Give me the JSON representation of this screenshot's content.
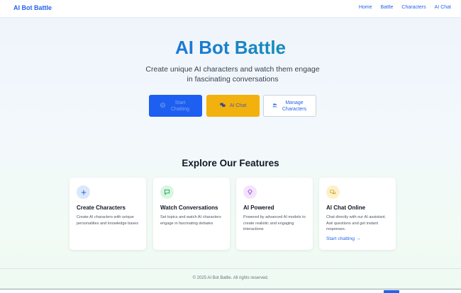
{
  "header": {
    "brand": "AI Bot Battle",
    "nav": [
      "Home",
      "Battle",
      "Characters",
      "AI Chat"
    ]
  },
  "hero": {
    "title": "AI Bot Battle",
    "subtitle": "Create unique AI characters and watch them engage in fascinating conversations",
    "buttons": {
      "start": "Start Chatting",
      "chat": "AI Chat",
      "manage": "Manage Characters"
    }
  },
  "features": {
    "title": "Explore Our Features",
    "cards": [
      {
        "icon": "plus-icon",
        "title": "Create Characters",
        "desc": "Create AI characters with unique personalities and knowledge bases"
      },
      {
        "icon": "message-square-icon",
        "title": "Watch Conversations",
        "desc": "Set topics and watch AI characters engage in fascinating debates"
      },
      {
        "icon": "lightbulb-icon",
        "title": "AI Powered",
        "desc": "Powered by advanced AI models to create realistic and engaging interactions"
      },
      {
        "icon": "chat-bubbles-icon",
        "title": "AI Chat Online",
        "desc": "Chat directly with our AI assistant. Ask questions and get instant responses.",
        "link": "Start chatting →"
      }
    ]
  },
  "footer": {
    "text": "© 2025 AI Bot Battle. All rights reserved."
  },
  "colors": {
    "primary": "#2563eb",
    "accent_teal": "#0ea5a0",
    "chat_button": "#f2b10c",
    "start_button": "#1d5ff0"
  }
}
